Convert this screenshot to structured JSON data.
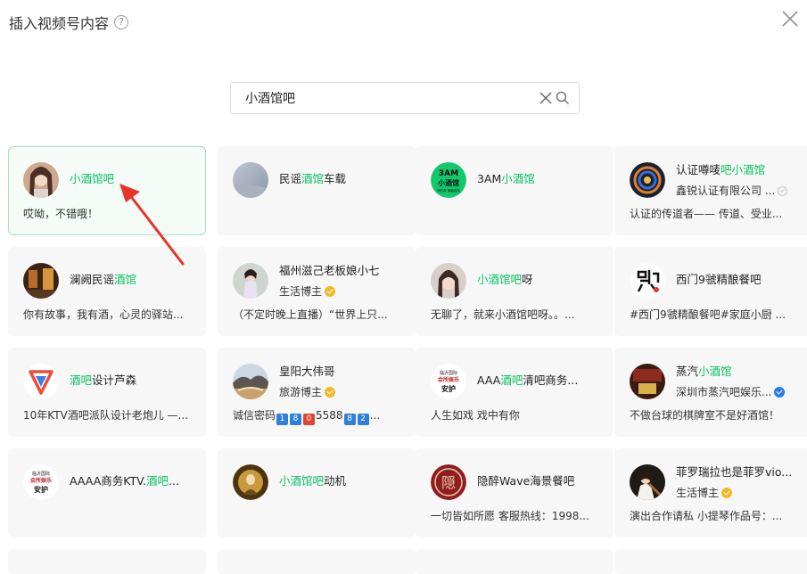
{
  "dialog": {
    "title": "插入视频号内容",
    "help_icon": "?"
  },
  "search": {
    "value": "小酒馆吧",
    "placeholder": ""
  },
  "colors": {
    "highlight": "#07c160",
    "selected_border": "#a8e2be",
    "arrow": "#e8332a"
  },
  "cards": [
    {
      "name": [
        "",
        "小酒馆吧",
        ""
      ],
      "desc": "哎呦，不错哦！"
    },
    {
      "name": [
        "民谣",
        "酒馆",
        "车载"
      ],
      "desc": ""
    },
    {
      "name": [
        "3AM",
        "小酒馆",
        ""
      ],
      "desc": "",
      "avatar_text": [
        "3AM",
        "小酒馆",
        "明日再 清晨自然"
      ]
    },
    {
      "name": [
        "认证噂唛",
        "吧小酒馆",
        ""
      ],
      "sub": "鑫锐认证有限公司 ...",
      "desc": "认证的传道者—— 传道、受业..."
    },
    {
      "name": [
        "澜阙民谣",
        "酒馆",
        ""
      ],
      "desc": "你有故事，我有酒，心灵的驿站..."
    },
    {
      "name": [
        "福州滋己老板娘小七",
        "",
        ""
      ],
      "sub": "生活博主",
      "desc": "（不定时晚上直播）“世界上只..."
    },
    {
      "name": [
        "",
        "小酒馆吧",
        "呀"
      ],
      "desc": "无聊了，就来小酒馆吧呀。。..."
    },
    {
      "name": [
        "西门9虢精酿餐吧",
        "",
        ""
      ],
      "desc": "#西门9虢精酿餐吧#家庭小厨 ..."
    },
    {
      "name": [
        "",
        "酒吧",
        "设计芦森"
      ],
      "desc": "10年KTV酒吧派队设计老炮儿 —..."
    },
    {
      "name": [
        "皇阳大伟哥",
        "",
        ""
      ],
      "sub": "旅游博主",
      "desc_parts": [
        "诚信密码",
        "1",
        "8",
        "0",
        "5588",
        "8",
        "2",
        "..."
      ]
    },
    {
      "name": [
        "AAA",
        "酒吧",
        "清吧商务..."
      ],
      "desc": "人生如戏 戏中有你",
      "avatar_text": [
        "临沂国际",
        "会所娱乐",
        "安护"
      ]
    },
    {
      "name": [
        "蒸汽",
        "小酒馆",
        ""
      ],
      "sub": "深圳市蒸汽吧娱乐...",
      "desc": "不做台球的棋牌室不是好酒馆！"
    },
    {
      "name": [
        "AAAA商务KTV.",
        "酒吧",
        "..."
      ],
      "desc": "",
      "avatar_text": [
        "临沂国际",
        "会所娱乐",
        "安护"
      ]
    },
    {
      "name": [
        "",
        "小酒馆吧",
        "动机"
      ],
      "desc": ""
    },
    {
      "name": [
        "隐醉Wave海景餐吧",
        "",
        ""
      ],
      "desc": "一切皆如所愿 客服热线：1998...",
      "avatar_text": [
        "隠"
      ]
    },
    {
      "name": [
        "菲罗瑞拉也是菲罗vio...",
        "",
        ""
      ],
      "sub": "生活博主",
      "desc": "演出合作请私 小提琴作品号：..."
    }
  ]
}
